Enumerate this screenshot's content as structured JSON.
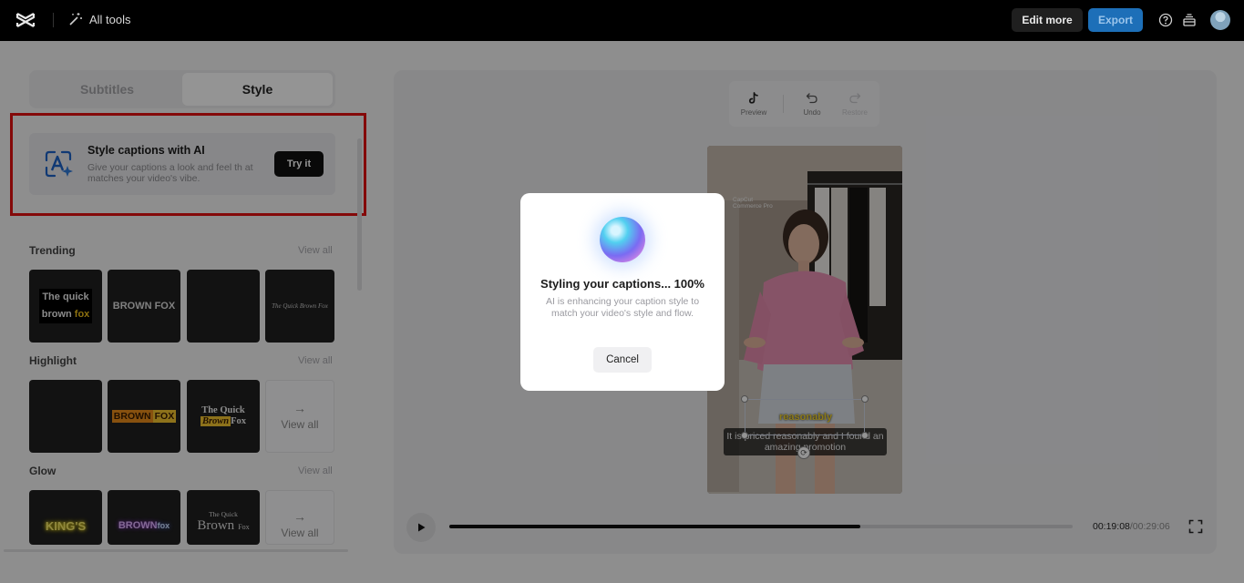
{
  "topbar": {
    "all_tools": "All tools",
    "edit_more": "Edit more",
    "export": "Export"
  },
  "tabs": [
    {
      "label": "Subtitles",
      "active": false
    },
    {
      "label": "Style",
      "active": true
    }
  ],
  "ai_card": {
    "title": "Style captions with AI",
    "description": "Give your captions a look and feel th at matches your video's vibe.",
    "button": "Try it"
  },
  "sections": {
    "trending": {
      "title": "Trending",
      "link": "View all"
    },
    "highlight": {
      "title": "Highlight",
      "link": "View all"
    },
    "glow": {
      "title": "Glow",
      "link": "View all"
    }
  },
  "tiles": {
    "trending": [
      "The quick",
      "brown",
      "fox",
      "BROWN FOX",
      "The Quick Brown Fox"
    ],
    "highlight": [
      "BROWN",
      "FOX",
      "The Quick",
      "Brown",
      "Fox",
      "View all"
    ],
    "glow": [
      "KING'S",
      "BROWN",
      "fox",
      "The Quick",
      "Brown",
      "Fox",
      "View all"
    ]
  },
  "toolbar": {
    "preview": "Preview",
    "undo": "Undo",
    "restore": "Restore"
  },
  "video": {
    "watermark_line1": "CapCut",
    "watermark_line2": "Commerce Pro",
    "highlight_word": "reasonably",
    "caption": "It is priced reasonably and I found an amazing promotion"
  },
  "player": {
    "current_time": "00:19:08",
    "total_time": "/00:29:06",
    "progress": 0.659
  },
  "modal": {
    "title": "Styling your captions... 100%",
    "description": "AI is enhancing your caption style to match your video's style and flow.",
    "cancel": "Cancel"
  },
  "colors": {
    "export_button": "#1d6fb8",
    "annotation_box": "#e41111",
    "highlight_word": "#f2d22a"
  }
}
